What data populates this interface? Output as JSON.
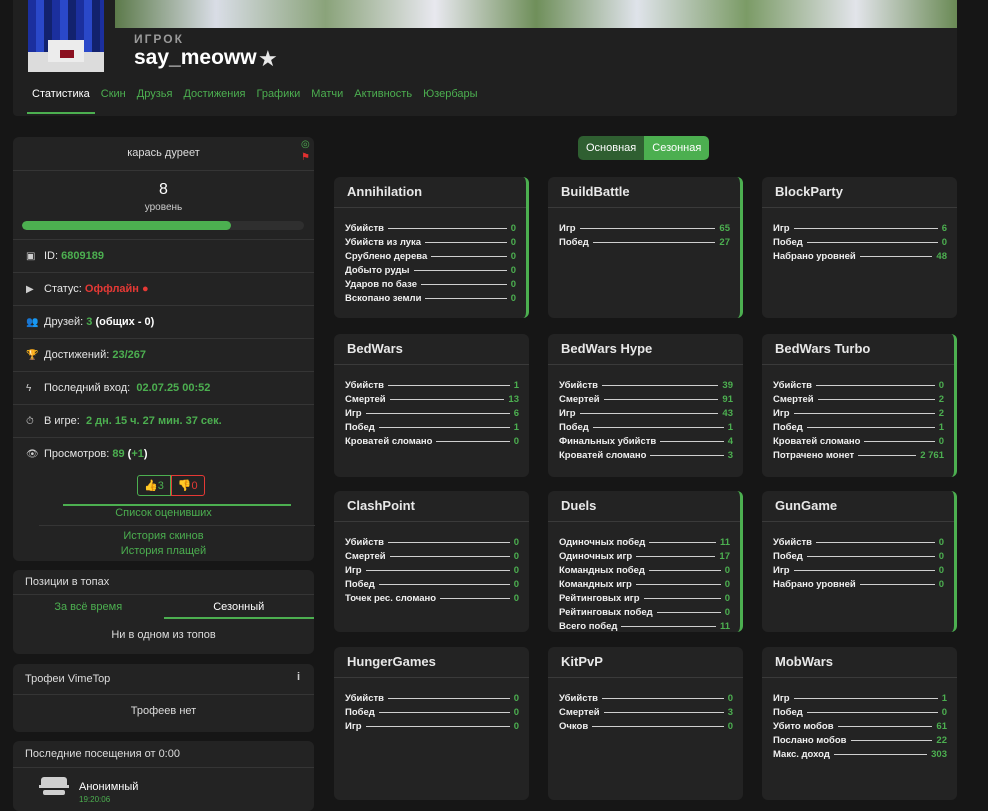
{
  "header": {
    "role": "ИГРОК",
    "player_name": "say_meoww",
    "tabs": [
      "Статистика",
      "Скин",
      "Друзья",
      "Достижения",
      "Графики",
      "Матчи",
      "Активность",
      "Юзербары"
    ]
  },
  "profile": {
    "status_text": "карась дуреет",
    "level": "8",
    "level_label": "уровень",
    "level_progress_percent": 74,
    "id_label": "ID:",
    "id_value": "6809189",
    "status_label": "Статус:",
    "status_value": "Оффлайн",
    "friends_label": "Друзей:",
    "friends_value": "3",
    "friends_extra": "(общих - 0)",
    "achievements_label": "Достижений:",
    "achievements_value": "23/267",
    "last_login_label": "Последний вход:",
    "last_login_value": "02.07.25 00:52",
    "ingame_label": "В игре:",
    "ingame_value": "2 дн. 15 ч. 27 мин. 37 сек.",
    "views_label": "Просмотров:",
    "views_value": "89",
    "views_delta_open": "(",
    "views_delta": "+1",
    "views_delta_close": ")",
    "likes": "3",
    "dislikes": "0",
    "raters_link": "Список оценивших",
    "skins_history": "История скинов",
    "capes_history": "История плащей"
  },
  "tops": {
    "title": "Позиции в топах",
    "tab_all": "За всё время",
    "tab_season": "Сезонный",
    "empty": "Ни в одном из топов"
  },
  "trophies": {
    "title": "Трофеи VimeTop",
    "info": "i",
    "empty": "Трофеев нет"
  },
  "visits": {
    "title": "Последние посещения от 0:00",
    "name": "Анонимный",
    "time": "19:20:06"
  },
  "toggle": {
    "main": "Основная",
    "season": "Сезонная"
  },
  "colors": {
    "accent": "#4caf50",
    "danger": "#e53935",
    "bg": "#161616",
    "card": "#232323"
  },
  "games": [
    {
      "title": "Annihilation",
      "stats": [
        [
          "Убийств",
          "0"
        ],
        [
          "Убийств из лука",
          "0"
        ],
        [
          "Срублено дерева",
          "0"
        ],
        [
          "Добыто руды",
          "0"
        ],
        [
          "Ударов по базе",
          "0"
        ],
        [
          "Вскопано земли",
          "0"
        ]
      ]
    },
    {
      "title": "BuildBattle",
      "stats": [
        [
          "Игр",
          "65"
        ],
        [
          "Побед",
          "27"
        ]
      ]
    },
    {
      "title": "BlockParty",
      "stats": [
        [
          "Игр",
          "6"
        ],
        [
          "Побед",
          "0"
        ],
        [
          "Набрано уровней",
          "48"
        ]
      ]
    },
    {
      "title": "BedWars",
      "stats": [
        [
          "Убийств",
          "1"
        ],
        [
          "Смертей",
          "13"
        ],
        [
          "Игр",
          "6"
        ],
        [
          "Побед",
          "1"
        ],
        [
          "Кроватей сломано",
          "0"
        ]
      ]
    },
    {
      "title": "BedWars Hype",
      "stats": [
        [
          "Убийств",
          "39"
        ],
        [
          "Смертей",
          "91"
        ],
        [
          "Игр",
          "43"
        ],
        [
          "Побед",
          "1"
        ],
        [
          "Финальных убийств",
          "4"
        ],
        [
          "Кроватей сломано",
          "3"
        ]
      ]
    },
    {
      "title": "BedWars Turbo",
      "stats": [
        [
          "Убийств",
          "0"
        ],
        [
          "Смертей",
          "2"
        ],
        [
          "Игр",
          "2"
        ],
        [
          "Побед",
          "1"
        ],
        [
          "Кроватей сломано",
          "0"
        ],
        [
          "Потрачено монет",
          "2 761"
        ]
      ]
    },
    {
      "title": "ClashPoint",
      "stats": [
        [
          "Убийств",
          "0"
        ],
        [
          "Смертей",
          "0"
        ],
        [
          "Игр",
          "0"
        ],
        [
          "Побед",
          "0"
        ],
        [
          "Точек рес. сломано",
          "0"
        ]
      ]
    },
    {
      "title": "Duels",
      "stats": [
        [
          "Одиночных побед",
          "11"
        ],
        [
          "Одиночных игр",
          "17"
        ],
        [
          "Командных побед",
          "0"
        ],
        [
          "Командных игр",
          "0"
        ],
        [
          "Рейтинговых игр",
          "0"
        ],
        [
          "Рейтинговых побед",
          "0"
        ],
        [
          "Всего побед",
          "11"
        ]
      ]
    },
    {
      "title": "GunGame",
      "stats": [
        [
          "Убийств",
          "0"
        ],
        [
          "Побед",
          "0"
        ],
        [
          "Игр",
          "0"
        ],
        [
          "Набрано уровней",
          "0"
        ]
      ]
    },
    {
      "title": "HungerGames",
      "stats": [
        [
          "Убийств",
          "0"
        ],
        [
          "Побед",
          "0"
        ],
        [
          "Игр",
          "0"
        ]
      ]
    },
    {
      "title": "KitPvP",
      "stats": [
        [
          "Убийств",
          "0"
        ],
        [
          "Смертей",
          "3"
        ],
        [
          "Очков",
          "0"
        ]
      ]
    },
    {
      "title": "MobWars",
      "stats": [
        [
          "Игр",
          "1"
        ],
        [
          "Побед",
          "0"
        ],
        [
          "Убито мобов",
          "61"
        ],
        [
          "Послано мобов",
          "22"
        ],
        [
          "Макс. доход",
          "303"
        ]
      ]
    }
  ]
}
